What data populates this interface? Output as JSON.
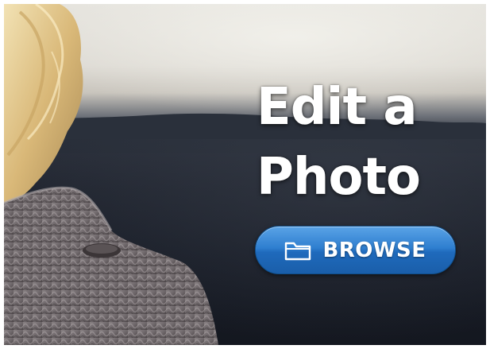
{
  "hero": {
    "headline_line1": "Edit a",
    "headline_line2": "Photo"
  },
  "browse_button": {
    "label": "BROWSE",
    "icon": "folder-icon"
  },
  "colors": {
    "button_blue": "#2f7fd0",
    "button_border": "#0f4f8c",
    "headline_text": "#ffffff"
  }
}
